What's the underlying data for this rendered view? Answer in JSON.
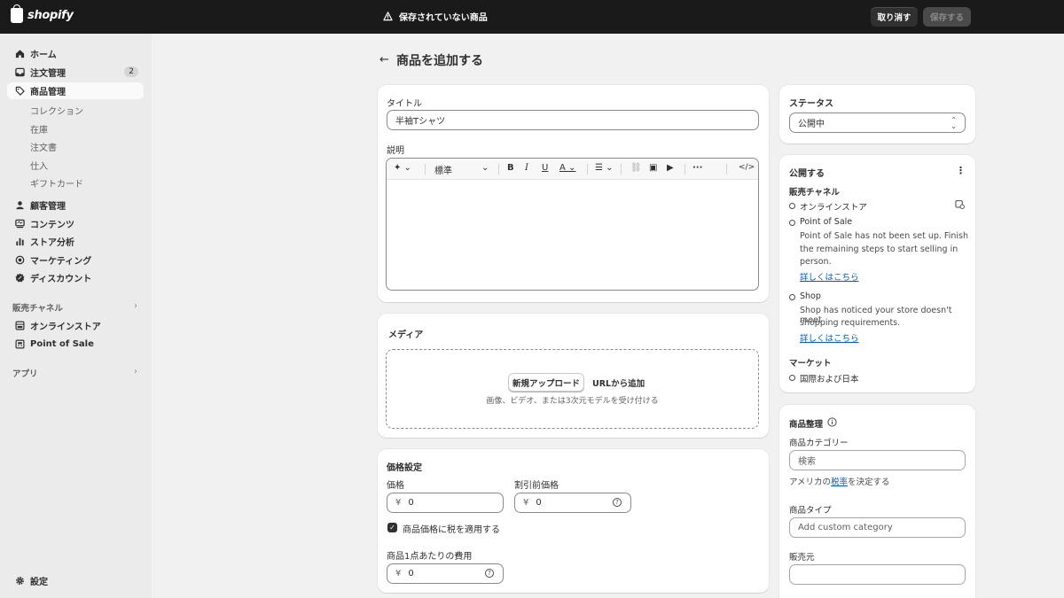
{
  "topbar": {
    "logo_text": "shopify",
    "unsaved_title": "保存されていない商品",
    "discard_label": "取り消す",
    "save_label": "保存する"
  },
  "sidebar": {
    "items": [
      {
        "label": "ホーム",
        "icon": "home-icon"
      },
      {
        "label": "注文管理",
        "icon": "inbox-icon",
        "badge": "2"
      },
      {
        "label": "商品管理",
        "icon": "tag-icon"
      },
      {
        "label": "顧客管理",
        "icon": "person-icon"
      },
      {
        "label": "コンテンツ",
        "icon": "content-icon"
      },
      {
        "label": "ストア分析",
        "icon": "analytics-icon"
      },
      {
        "label": "マーケティング",
        "icon": "target-icon"
      },
      {
        "label": "ディスカウント",
        "icon": "discount-icon"
      }
    ],
    "product_sub": [
      "コレクション",
      "在庫",
      "注文書",
      "仕入",
      "ギフトカード"
    ],
    "sales_channels_heading": "販売チャネル",
    "channels": [
      {
        "label": "オンラインストア",
        "icon": "store-icon"
      },
      {
        "label": "Point of Sale",
        "icon": "pos-icon"
      }
    ],
    "apps_heading": "アプリ",
    "settings_label": "設定"
  },
  "main": {
    "page_title": "商品を追加する",
    "title_label": "タイトル",
    "title_value": "半袖Tシャツ",
    "description_label": "説明",
    "editor_format": "標準",
    "media_heading": "メディア",
    "upload_button": "新規アップロード",
    "add_from_url": "URLから追加",
    "media_hint": "画像、ビデオ、または3次元モデルを受け付ける",
    "pricing_heading": "価格設定",
    "price_label": "価格",
    "price_prefix": "¥",
    "price_value": "0",
    "compare_label": "割引前価格",
    "compare_value": "0",
    "tax_checkbox_label": "商品価格に税を適用する",
    "cost_label": "商品1点あたりの費用",
    "cost_value": "0"
  },
  "right": {
    "status_heading": "ステータス",
    "status_value": "公開中",
    "publish_heading": "公開する",
    "sales_channels_label": "販売チャネル",
    "channel_online": "オンラインストア",
    "channel_pos": "Point of Sale",
    "pos_note_1": "Point of Sale has not been set up. Finish",
    "pos_note_2": "the remaining steps to start selling in",
    "pos_note_3": "person.",
    "learn_more": "詳しくはこちら",
    "channel_shop": "Shop",
    "shop_note_1": "Shop has noticed your store doesn't meet",
    "shop_note_2": "shopping requirements.",
    "market_heading": "マーケット",
    "market_value": "国際および日本",
    "org_heading": "商品整理",
    "category_label": "商品カテゴリー",
    "category_placeholder": "検索",
    "tax_note_prefix": "アメリカの",
    "tax_note_link": "税率",
    "tax_note_suffix": "を決定する",
    "type_label": "商品タイプ",
    "type_placeholder": "Add custom category",
    "vendor_label": "販売元"
  }
}
